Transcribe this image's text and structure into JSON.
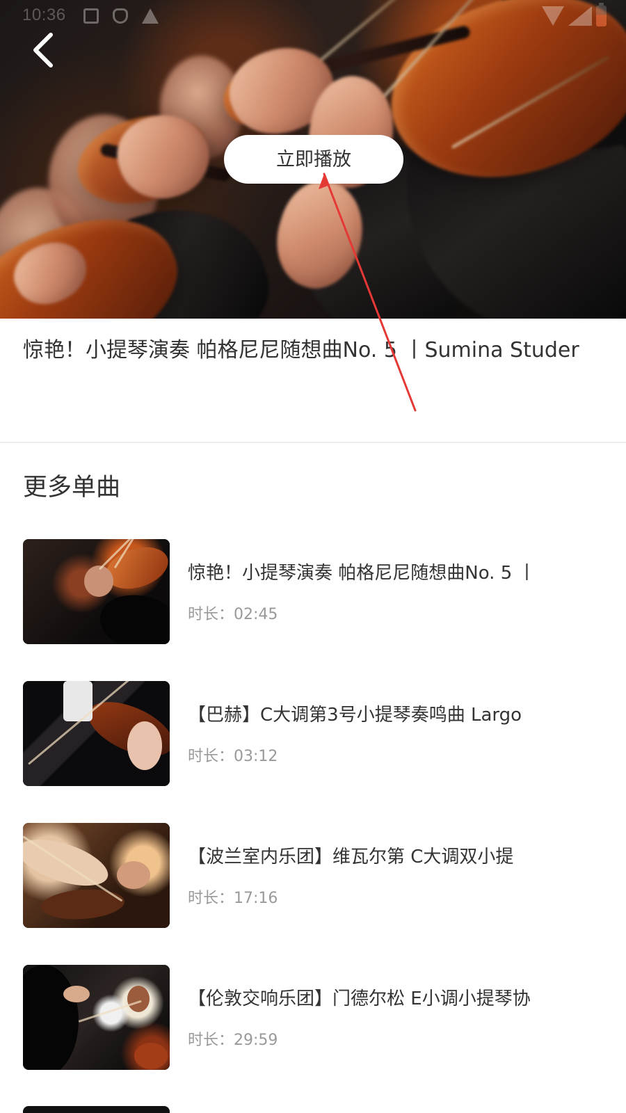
{
  "status_bar": {
    "time": "10:36"
  },
  "hero": {
    "play_label": "立即播放",
    "back_icon": "chevron-left-icon"
  },
  "title": {
    "text": "惊艳！小提琴演奏 帕格尼尼随想曲No. 5 丨Sumina Studer"
  },
  "section": {
    "heading": "更多单曲"
  },
  "tracks": [
    {
      "title": "惊艳！小提琴演奏 帕格尼尼随想曲No. 5 丨",
      "duration": "时长：02:45"
    },
    {
      "title": "【巴赫】C大调第3号小提琴奏鸣曲 Largo",
      "duration": "时长：03:12"
    },
    {
      "title": "【波兰室内乐团】维瓦尔第 C大调双小提",
      "duration": "时长：17:16"
    },
    {
      "title": "【伦敦交响乐团】门德尔松 E小调小提琴协",
      "duration": "时长：29:59"
    }
  ],
  "colors": {
    "primary_text": "#333333",
    "secondary_text": "#999999",
    "divider": "#eeeeee",
    "annotation_arrow": "#e53935"
  }
}
